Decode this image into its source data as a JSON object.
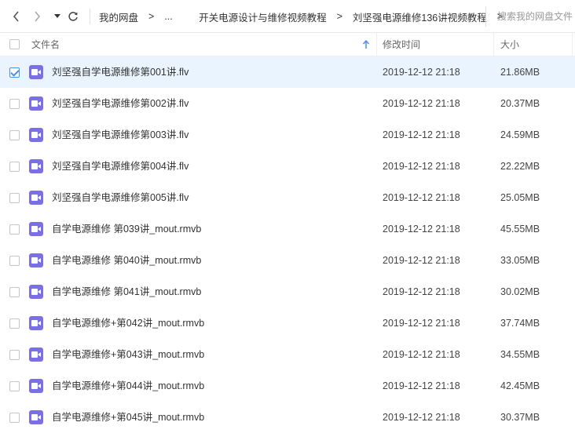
{
  "breadcrumbs": [
    "我的网盘",
    "...",
    "开关电源设计与维修视频教程",
    "刘坚强电源维修136讲视频教程"
  ],
  "breadcrumb_separator": ">",
  "search": {
    "placeholder": "搜索我的网盘文件"
  },
  "columns": {
    "name": "文件名",
    "modified": "修改时间",
    "size": "大小"
  },
  "sort": {
    "column": "name",
    "direction": "ascending"
  },
  "colors": {
    "selected_row": "#e9f4fe",
    "video_icon": "#7b6fe6",
    "checkbox_checked": "#4a90e2"
  },
  "files": [
    {
      "name": "刘坚强自学电源维修第001讲.flv",
      "modified": "2019-12-12 21:18",
      "size": "21.86MB",
      "selected": true,
      "icon": "video-file-icon"
    },
    {
      "name": "刘坚强自学电源维修第002讲.flv",
      "modified": "2019-12-12 21:18",
      "size": "20.37MB",
      "selected": false,
      "icon": "video-file-icon"
    },
    {
      "name": "刘坚强自学电源维修第003讲.flv",
      "modified": "2019-12-12 21:18",
      "size": "24.59MB",
      "selected": false,
      "icon": "video-file-icon"
    },
    {
      "name": "刘坚强自学电源维修第004讲.flv",
      "modified": "2019-12-12 21:18",
      "size": "22.22MB",
      "selected": false,
      "icon": "video-file-icon"
    },
    {
      "name": "刘坚强自学电源维修第005讲.flv",
      "modified": "2019-12-12 21:18",
      "size": "25.05MB",
      "selected": false,
      "icon": "video-file-icon"
    },
    {
      "name": "自学电源维修 第039讲_mout.rmvb",
      "modified": "2019-12-12 21:18",
      "size": "45.55MB",
      "selected": false,
      "icon": "video-file-icon"
    },
    {
      "name": "自学电源维修 第040讲_mout.rmvb",
      "modified": "2019-12-12 21:18",
      "size": "33.05MB",
      "selected": false,
      "icon": "video-file-icon"
    },
    {
      "name": "自学电源维修 第041讲_mout.rmvb",
      "modified": "2019-12-12 21:18",
      "size": "30.02MB",
      "selected": false,
      "icon": "video-file-icon"
    },
    {
      "name": "自学电源维修+第042讲_mout.rmvb",
      "modified": "2019-12-12 21:18",
      "size": "37.74MB",
      "selected": false,
      "icon": "video-file-icon"
    },
    {
      "name": "自学电源维修+第043讲_mout.rmvb",
      "modified": "2019-12-12 21:18",
      "size": "34.55MB",
      "selected": false,
      "icon": "video-file-icon"
    },
    {
      "name": "自学电源维修+第044讲_mout.rmvb",
      "modified": "2019-12-12 21:18",
      "size": "42.45MB",
      "selected": false,
      "icon": "video-file-icon"
    },
    {
      "name": "自学电源维修+第045讲_mout.rmvb",
      "modified": "2019-12-12 21:18",
      "size": "30.37MB",
      "selected": false,
      "icon": "video-file-icon"
    }
  ]
}
